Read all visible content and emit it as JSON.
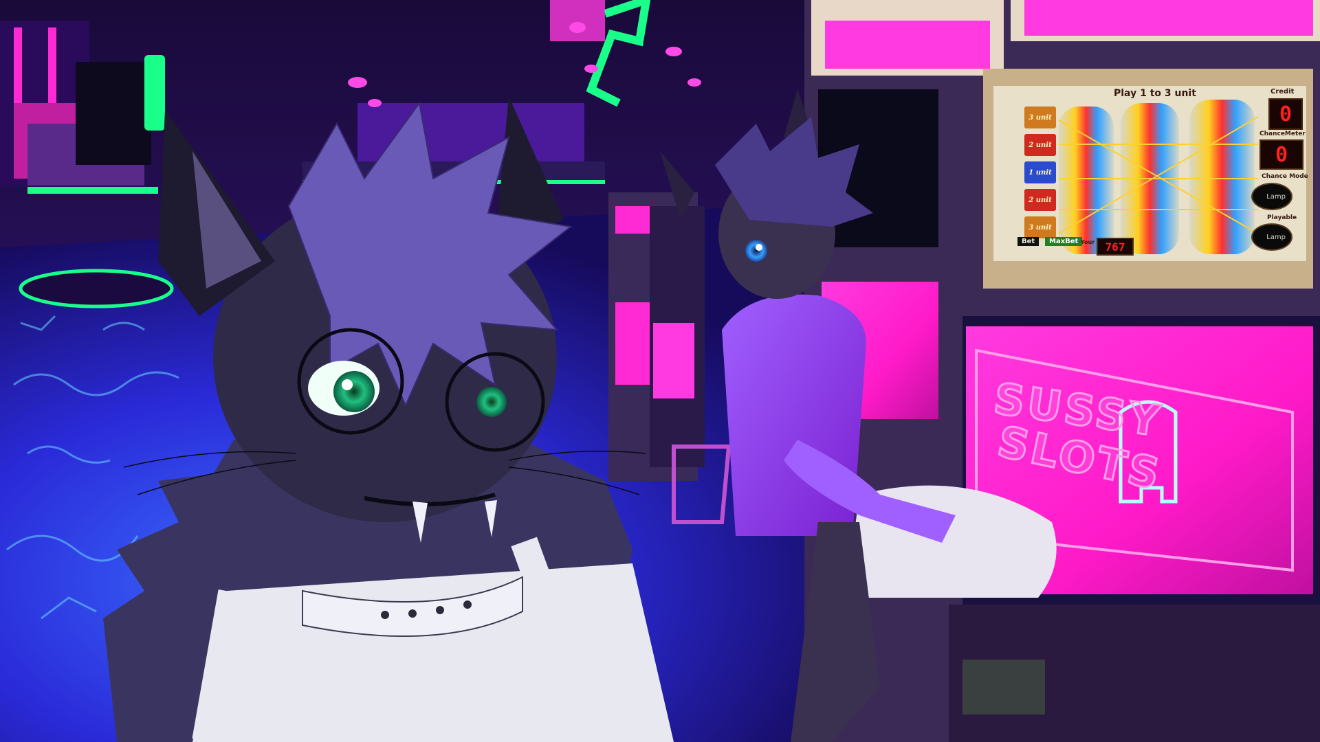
{
  "scene": {
    "type": "vr-game-screenshot",
    "setting": "neon casino interior",
    "main_character": "black-and-purple cat avatar with round glasses and spiked collar",
    "second_character": "cat avatar in purple hoodie sitting at slot machine"
  },
  "slot_machine": {
    "header_label": "Play 1 to 3 unit",
    "sign_line1": "SUSSY",
    "sign_line2": "SLOTS",
    "paylines": [
      "3 unit",
      "2 unit",
      "1 unit",
      "2 unit",
      "3 unit"
    ],
    "bet_label": "Bet",
    "maxbet_label": "MaxBet",
    "your_money_label": "Your Money",
    "your_money_value": "767",
    "credit_label": "Credit",
    "credit_value": "0",
    "chance_meter_label": "ChanceMeter",
    "chance_meter_value": "0",
    "chance_mode_label": "Chance Mode",
    "chance_mode_button": "Lamp",
    "playable_label": "Playable",
    "playable_button": "Lamp"
  },
  "colors": {
    "neon_pink": "#ff2ad4",
    "neon_green": "#19ff8a",
    "neon_purple": "#8a3cff",
    "floor_blue": "#2b3aff",
    "machine_body": "#4a3a6a"
  }
}
